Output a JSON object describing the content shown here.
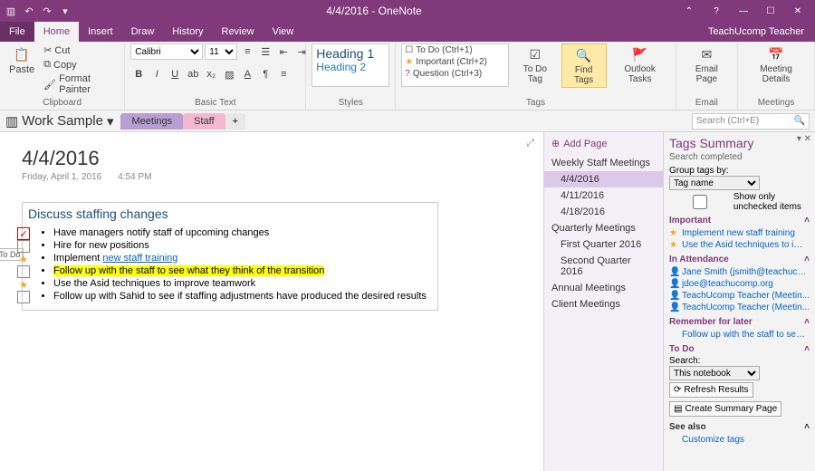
{
  "titlebar": {
    "title": "4/4/2016 - OneNote"
  },
  "menu": {
    "file": "File",
    "home": "Home",
    "insert": "Insert",
    "draw": "Draw",
    "history": "History",
    "review": "Review",
    "view": "View",
    "account": "TeachUcomp Teacher"
  },
  "ribbon": {
    "clipboard": {
      "paste": "Paste",
      "cut": "Cut",
      "copy": "Copy",
      "painter": "Format Painter",
      "label": "Clipboard"
    },
    "font": {
      "name": "Calibri",
      "size": "11",
      "label": "Basic Text"
    },
    "styles": {
      "h1": "Heading 1",
      "h2": "Heading 2",
      "label": "Styles"
    },
    "tags": {
      "todo": "To Do (Ctrl+1)",
      "important": "Important (Ctrl+2)",
      "question": "Question (Ctrl+3)",
      "todotag": "To Do Tag",
      "find": "Find Tags",
      "outlook": "Outlook Tasks",
      "label": "Tags"
    },
    "email": {
      "btn": "Email Page",
      "label": "Email"
    },
    "meetings": {
      "btn": "Meeting Details",
      "label": "Meetings"
    }
  },
  "nav": {
    "notebook": "Work Sample",
    "tab1": "Meetings",
    "tab2": "Staff",
    "add": "+",
    "search": "Search (Ctrl+E)"
  },
  "page": {
    "title": "4/4/2016",
    "date": "Friday, April 1, 2016",
    "time": "4:54 PM",
    "note_title": "Discuss staffing changes",
    "items": [
      "Have managers notify staff of upcoming changes",
      "Hire for new positions",
      "Implement ",
      "new staff training",
      "Follow up with the staff to see what they think of the transition",
      "Use the Asid techniques to improve teamwork",
      "Follow up with Sahid to see if staffing adjustments have produced the desired results"
    ],
    "todo_label": "To Do"
  },
  "pages": {
    "add": "Add Page",
    "p1": "Weekly Staff Meetings",
    "p1a": "4/4/2016",
    "p1b": "4/11/2016",
    "p1c": "4/18/2016",
    "p2": "Quarterly Meetings",
    "p2a": "First Quarter 2016",
    "p2b": "Second Quarter 2016",
    "p3": "Annual Meetings",
    "p4": "Client Meetings"
  },
  "pane": {
    "title": "Tags Summary",
    "completed": "Search completed",
    "groupby": "Group tags by:",
    "groupval": "Tag name",
    "showonly": "Show only unchecked items",
    "sec_important": "Important",
    "imp1": "Implement new staff training",
    "imp2": "Use the Asid techniques to imp...",
    "sec_attend": "In Attendance",
    "a1": "Jane Smith (jsmith@teachuco...",
    "a2": "jdoe@teachucomp.org",
    "a3": "TeachUcomp Teacher (Meetin...",
    "a4": "TeachUcomp Teacher (Meetin...",
    "sec_remember": "Remember for later",
    "r1": "Follow up with the staff to see what ...",
    "sec_todo": "To Do",
    "search": "Search:",
    "searchval": "This notebook",
    "refresh": "Refresh Results",
    "summary": "Create Summary Page",
    "seealso": "See also",
    "custom": "Customize tags"
  }
}
